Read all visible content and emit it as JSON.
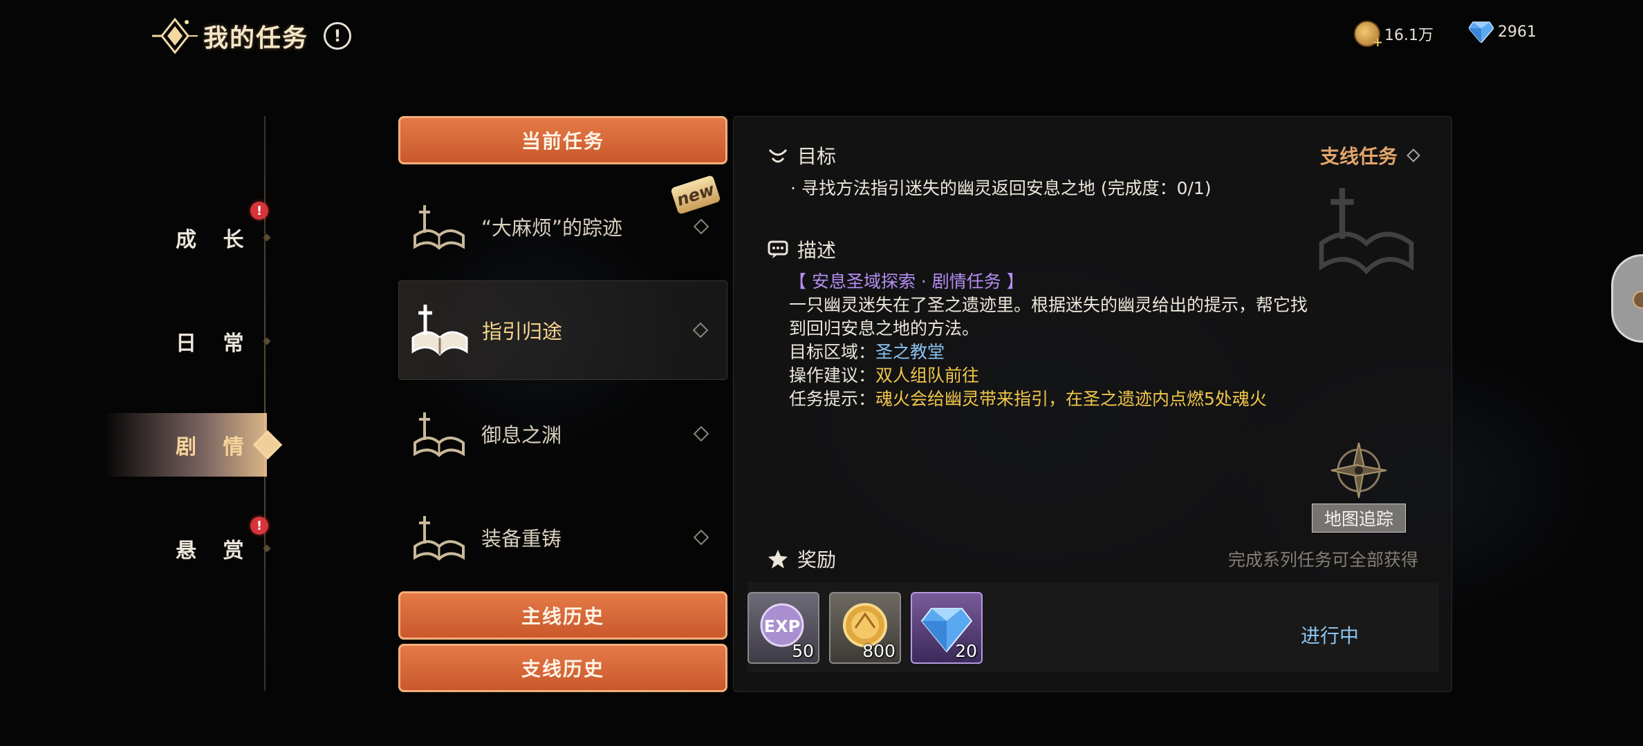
{
  "header": {
    "title": "我的任务",
    "info_symbol": "!"
  },
  "currency": {
    "coins": "16.1万",
    "gems": "2961"
  },
  "nav": {
    "items": [
      {
        "label": "成 长",
        "badge": "!"
      },
      {
        "label": "日 常"
      },
      {
        "label": "剧 情",
        "active": true
      },
      {
        "label": "悬 赏",
        "badge": "!"
      }
    ]
  },
  "quest_list": {
    "header_button": "当前任务",
    "items": [
      {
        "label": "“大麻烦”的踪迹",
        "new_tag": "new"
      },
      {
        "label": "指引归途",
        "active": true
      },
      {
        "label": "御息之渊"
      },
      {
        "label": "装备重铸"
      }
    ],
    "main_history_button": "主线历史",
    "side_history_button": "支线历史"
  },
  "detail": {
    "goal_title": "目标",
    "quest_type": "支线任务",
    "goal_text": "· 寻找方法指引迷失的幽灵返回安息之地 (完成度：0/1)",
    "desc_title": "描述",
    "tagline": "【 安息圣域探索 · 剧情任务 】",
    "desc_line1": "一只幽灵迷失在了圣之遗迹里。根据迷失的幽灵给出的提示，帮它找",
    "desc_line2": "到回归安息之地的方法。",
    "area_label": "目标区域：",
    "area_value": "圣之教堂",
    "advice_label": "操作建议：",
    "advice_value": "双人组队前往",
    "hint_label": "任务提示：",
    "hint_value": "魂火会给幽灵带来指引，在圣之遗迹内点燃5处魂火",
    "map_track_button": "地图追踪",
    "reward_title": "奖励",
    "reward_note": "完成系列任务可全部获得",
    "rewards": [
      {
        "icon": "exp-icon",
        "label": "EXP",
        "qty": "50"
      },
      {
        "icon": "gold-coin-icon",
        "qty": "800"
      },
      {
        "icon": "diamond-icon",
        "qty": "20"
      }
    ],
    "status": "进行中"
  },
  "colors": {
    "accent_orange": "#d9663a",
    "gold_text": "#f0c64a",
    "blue_text": "#8cc3ef",
    "purple_text": "#b58df2",
    "side_quest_text": "#e4a66a"
  }
}
